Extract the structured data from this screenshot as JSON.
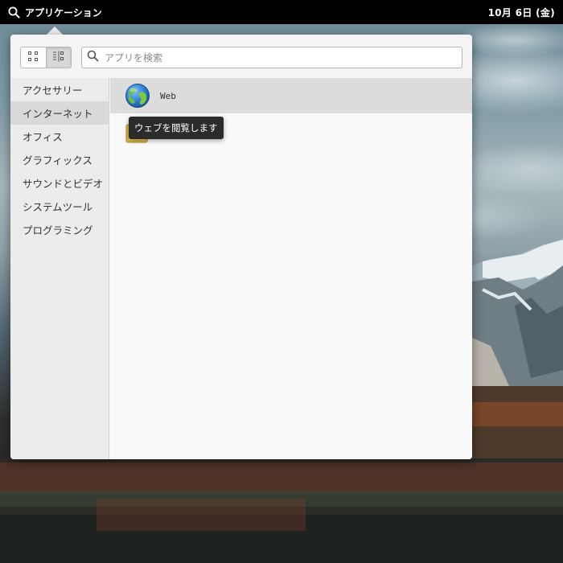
{
  "panel": {
    "applications_label": "アプリケーション",
    "clock": "10月 6日 (金)"
  },
  "launcher": {
    "search": {
      "placeholder": "アプリを検索",
      "value": ""
    },
    "view_modes": [
      {
        "name": "grid",
        "icon": "grid-view-icon",
        "active": false
      },
      {
        "name": "category",
        "icon": "category-view-icon",
        "active": true
      }
    ],
    "categories": [
      {
        "label": "アクセサリー",
        "selected": false
      },
      {
        "label": "インターネット",
        "selected": true
      },
      {
        "label": "オフィス",
        "selected": false
      },
      {
        "label": "グラフィックス",
        "selected": false
      },
      {
        "label": "サウンドとビデオ",
        "selected": false
      },
      {
        "label": "システムツール",
        "selected": false
      },
      {
        "label": "プログラミング",
        "selected": false
      }
    ],
    "apps": [
      {
        "name": "Web",
        "icon": "globe-icon"
      },
      {
        "name": "",
        "icon": "app-icon"
      }
    ],
    "tooltip": "ウェブを閲覧します"
  },
  "colors": {
    "panel_bg": "#000000",
    "popover_bg": "#f4f4f4",
    "selected_row": "#d9d9d9",
    "tooltip_bg": "#2b2b2b"
  }
}
